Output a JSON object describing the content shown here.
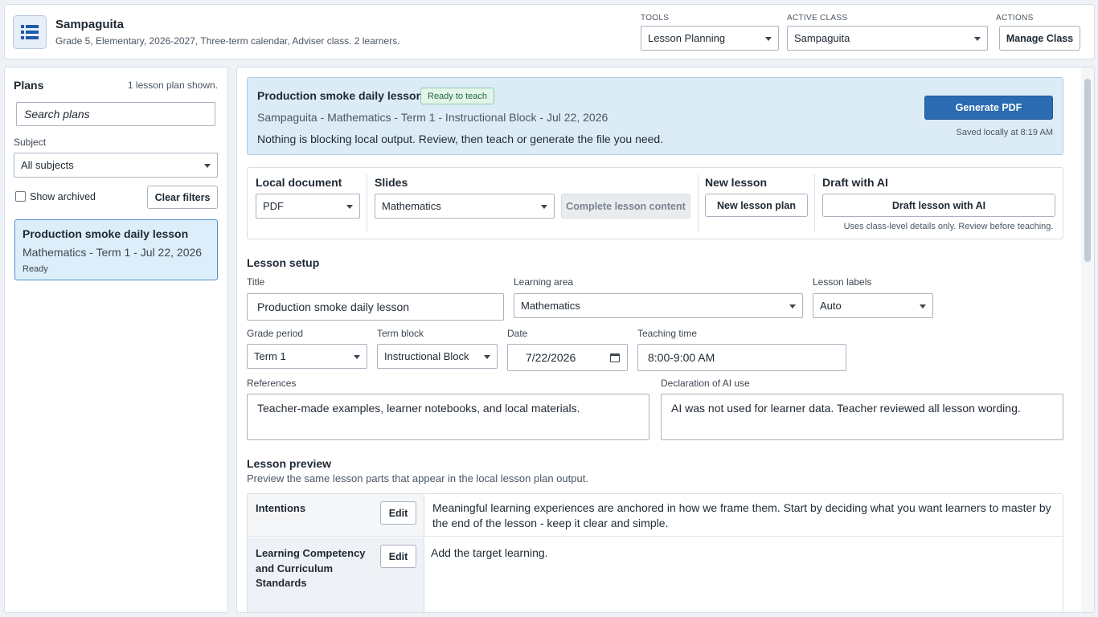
{
  "header": {
    "app_icon": "list-table-icon",
    "title": "Sampaguita",
    "subtitle": "Grade 5, Elementary, 2026-2027, Three-term calendar, Adviser class. 2 learners.",
    "tools_label": "TOOLS",
    "tools_value": "Lesson Planning",
    "active_class_label": "ACTIVE CLASS",
    "active_class_value": "Sampaguita",
    "actions_label": "ACTIONS",
    "manage_class_label": "Manage Class"
  },
  "sidebar": {
    "title": "Plans",
    "count": "1 lesson plan shown.",
    "search_placeholder": "Search plans",
    "subject_label": "Subject",
    "subject_value": "All subjects",
    "show_archived_label": "Show archived",
    "show_archived_checked": false,
    "clear_filters_label": "Clear filters",
    "plans": [
      {
        "title": "Production smoke daily lesson",
        "subtitle": "Mathematics - Term 1 - Jul 22, 2026",
        "status": "Ready"
      }
    ]
  },
  "status_panel": {
    "title": "Production smoke daily lesson",
    "badge": "Ready to teach",
    "subtitle": "Sampaguita - Mathematics - Term 1 - Instructional Block - Jul 22, 2026",
    "message": "Nothing is blocking local output. Review, then teach or generate the file you need.",
    "generate_label": "Generate PDF",
    "saved_text": "Saved locally at 8:19 AM"
  },
  "toolbar": {
    "local_document_label": "Local document",
    "local_document_value": "PDF",
    "slides_label": "Slides",
    "slides_value": "Mathematics",
    "complete_content_label": "Complete lesson content",
    "new_lesson_label": "New lesson",
    "new_lesson_plan_label": "New lesson plan",
    "draft_ai_label": "Draft with AI",
    "draft_ai_button": "Draft lesson with AI",
    "draft_ai_hint": "Uses class-level details only. Review before teaching."
  },
  "setup": {
    "section_title": "Lesson setup",
    "title_label": "Title",
    "title_value": "Production smoke daily lesson",
    "learning_area_label": "Learning area",
    "learning_area_value": "Mathematics",
    "lesson_labels_label": "Lesson labels",
    "lesson_labels_value": "Auto",
    "grade_period_label": "Grade period",
    "grade_period_value": "Term 1",
    "term_block_label": "Term block",
    "term_block_value": "Instructional Block",
    "date_label": "Date",
    "date_value": "7/22/2026",
    "teaching_time_label": "Teaching time",
    "teaching_time_value": "8:00-9:00 AM",
    "references_label": "References",
    "references_value": "Teacher-made examples, learner notebooks, and local materials.",
    "ai_use_label": "Declaration of AI use",
    "ai_use_value": "AI was not used for learner data. Teacher reviewed all lesson wording."
  },
  "preview": {
    "section_title": "Lesson preview",
    "subtitle": "Preview the same lesson parts that appear in the local lesson plan output.",
    "edit_label": "Edit",
    "rows": [
      {
        "name": "Intentions",
        "text": "Meaningful learning experiences are anchored in how we frame them. Start by deciding what you want learners to master by the end of the lesson - keep it clear and simple."
      },
      {
        "name": "Learning Competency and Curriculum Standards",
        "text": "Add the target learning."
      }
    ]
  }
}
